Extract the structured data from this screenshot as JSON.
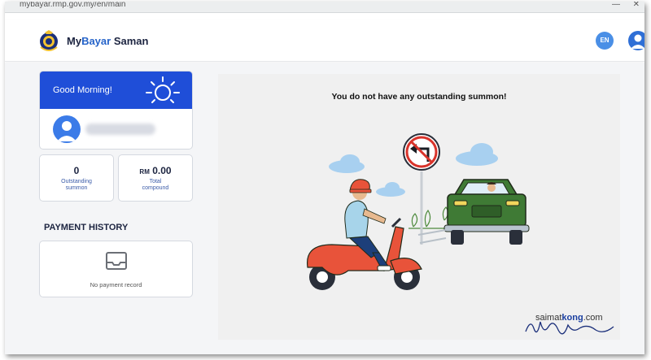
{
  "browser": {
    "url": "mybayar.rmp.gov.my/en/main"
  },
  "header": {
    "brand_prefix": "My",
    "brand_accent": "Bayar",
    "brand_suffix": " Saman",
    "lang_label": "EN"
  },
  "greeting": {
    "text": "Good Morning!"
  },
  "stats": {
    "outstanding": {
      "value": "0",
      "label_line1": "Outstanding",
      "label_line2": "summon"
    },
    "compound": {
      "currency": "RM",
      "value": "0.00",
      "label_line1": "Total",
      "label_line2": "compound"
    }
  },
  "payment_history": {
    "title": "PAYMENT HISTORY",
    "empty_text": "No payment record"
  },
  "main": {
    "message": "You do not have any outstanding summon!"
  },
  "watermark": {
    "prefix": "saimat",
    "accent": "kong",
    "suffix": ".com"
  },
  "colors": {
    "primary": "#1f4ed8",
    "accent": "#2563c9",
    "scooter": "#e8533a",
    "car": "#3f7a35"
  },
  "icons": {
    "logo": "police-crest-icon",
    "sun": "sun-icon",
    "avatar": "user-avatar-icon",
    "inbox": "inbox-tray-icon",
    "sign": "no-left-turn-sign-icon"
  }
}
